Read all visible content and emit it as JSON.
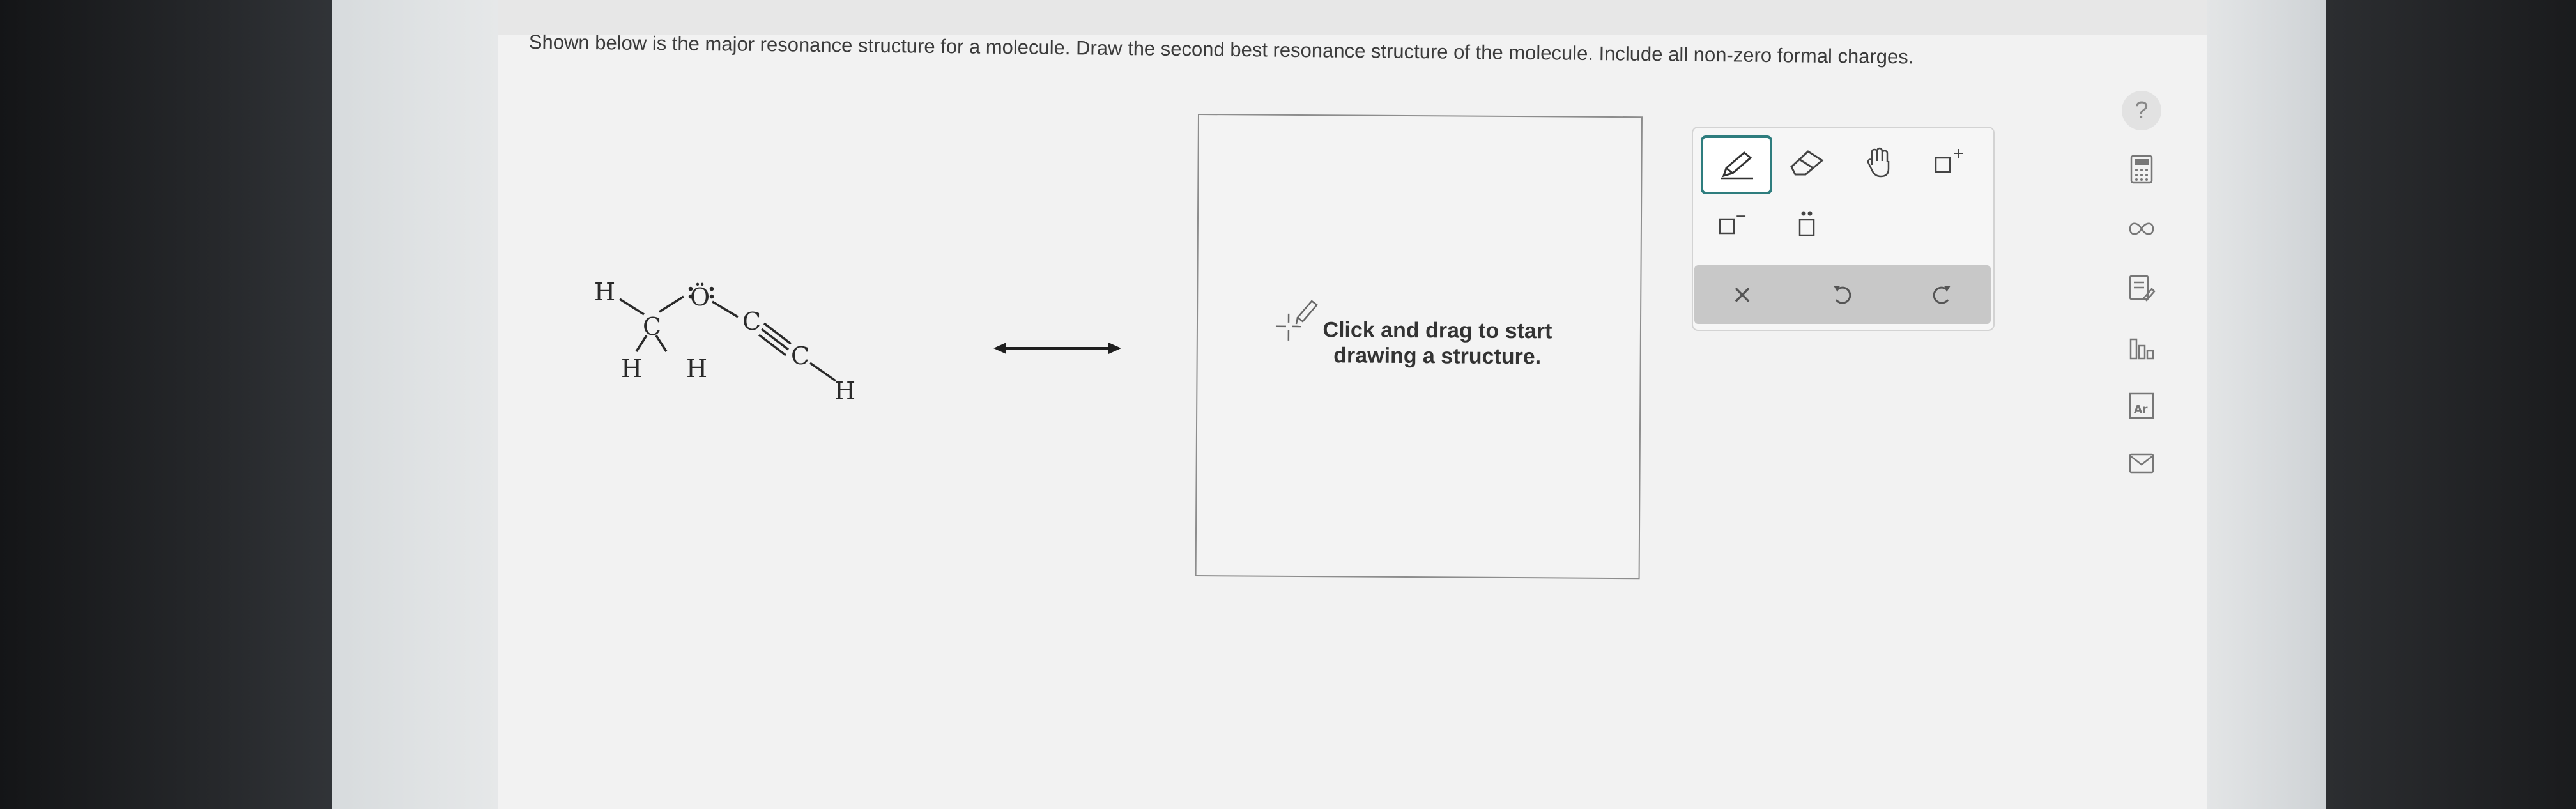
{
  "question": {
    "prompt": "Shown below is the major resonance structure for a molecule. Draw the second best resonance structure of the molecule. Include all non-zero formal charges."
  },
  "molecule": {
    "atoms": [
      "H",
      "C",
      "Ö",
      "C",
      "C",
      "H",
      "H",
      "H"
    ]
  },
  "drawing_canvas": {
    "hint": "Click and drag to start drawing a structure."
  },
  "toolbar": {
    "tools": [
      "pencil-icon",
      "eraser-icon",
      "hand-icon",
      "positive-charge-icon",
      "negative-charge-icon",
      "lone-pair-icon"
    ],
    "actions": [
      "clear-icon",
      "undo-icon",
      "redo-icon"
    ],
    "clear_symbol": "×",
    "positive_charge": "+",
    "negative_charge": "−"
  },
  "side_tools": {
    "help": "?",
    "icons": [
      "calculator-icon",
      "infinity-icon",
      "notes-icon",
      "chart-icon",
      "periodic-table-icon",
      "mail-icon"
    ],
    "periodic_label": "Ar"
  },
  "colors": {
    "accent": "#2e7d7e"
  }
}
